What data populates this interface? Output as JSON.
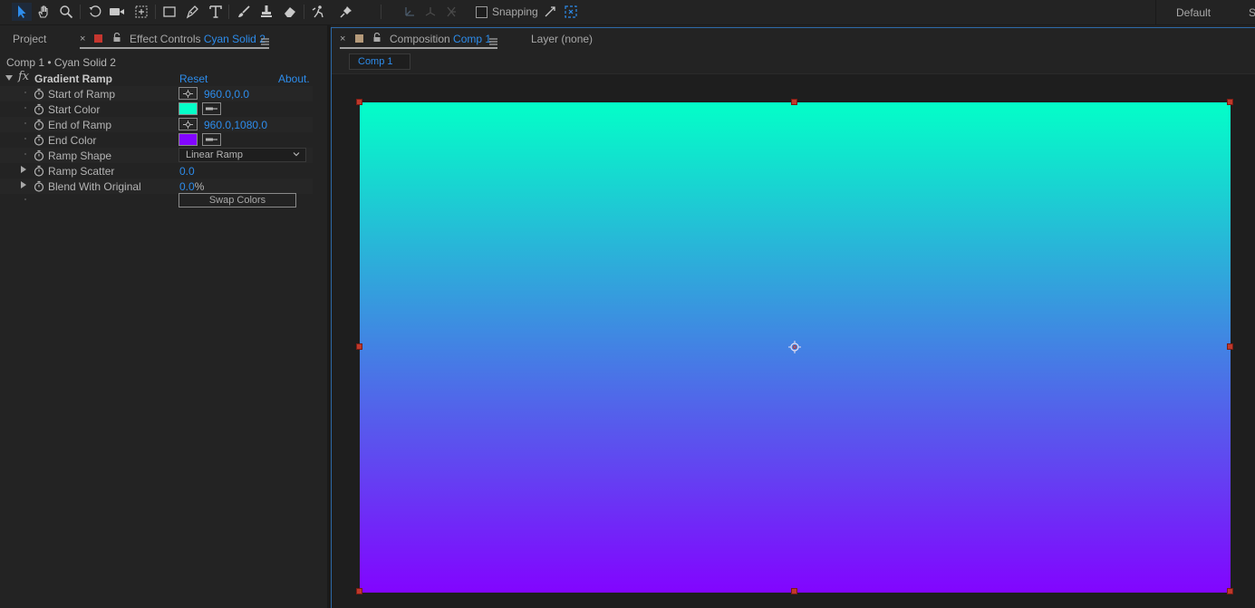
{
  "toolbar": {
    "snapping_label": "Snapping",
    "workspace": "Default",
    "workspace_overflow": "S",
    "tools": [
      "selection-tool",
      "hand-tool",
      "zoom-tool",
      "rotate-tool",
      "camera-tool",
      "pan-behind-tool",
      "rectangle-tool",
      "pen-tool",
      "type-tool",
      "brush-tool",
      "clone-stamp-tool",
      "eraser-tool",
      "roto-brush-tool",
      "puppet-pin-tool"
    ]
  },
  "left_panel": {
    "project_tab": "Project",
    "effect_controls_label": "Effect Controls",
    "effect_controls_layer": "Cyan Solid 2",
    "layer_path": "Comp 1 • Cyan Solid 2",
    "effect": {
      "fx": "fx",
      "name": "Gradient Ramp",
      "reset": "Reset",
      "about": "About."
    },
    "properties": {
      "start_of_ramp": {
        "label": "Start of Ramp",
        "value": "960.0,0.0"
      },
      "start_color": {
        "label": "Start Color",
        "color": "#03ffc8"
      },
      "end_of_ramp": {
        "label": "End of Ramp",
        "value": "960.0,1080.0"
      },
      "end_color": {
        "label": "End Color",
        "color": "#8205ff"
      },
      "ramp_shape": {
        "label": "Ramp Shape",
        "value": "Linear Ramp"
      },
      "ramp_scatter": {
        "label": "Ramp Scatter",
        "value": "0.0"
      },
      "blend_with_original": {
        "label": "Blend With Original",
        "value": "0.0",
        "unit": "%"
      },
      "swap_colors": "Swap Colors"
    }
  },
  "comp_panel": {
    "composition_label": "Composition",
    "composition_name": "Comp 1",
    "layer_tab": "Layer  (none)",
    "sub_tab": "Comp 1"
  },
  "colors": {
    "accent": "#2d8ceb",
    "gradient_start": "#03ffc8",
    "gradient_end": "#8205ff",
    "handle": "#c0392b"
  }
}
